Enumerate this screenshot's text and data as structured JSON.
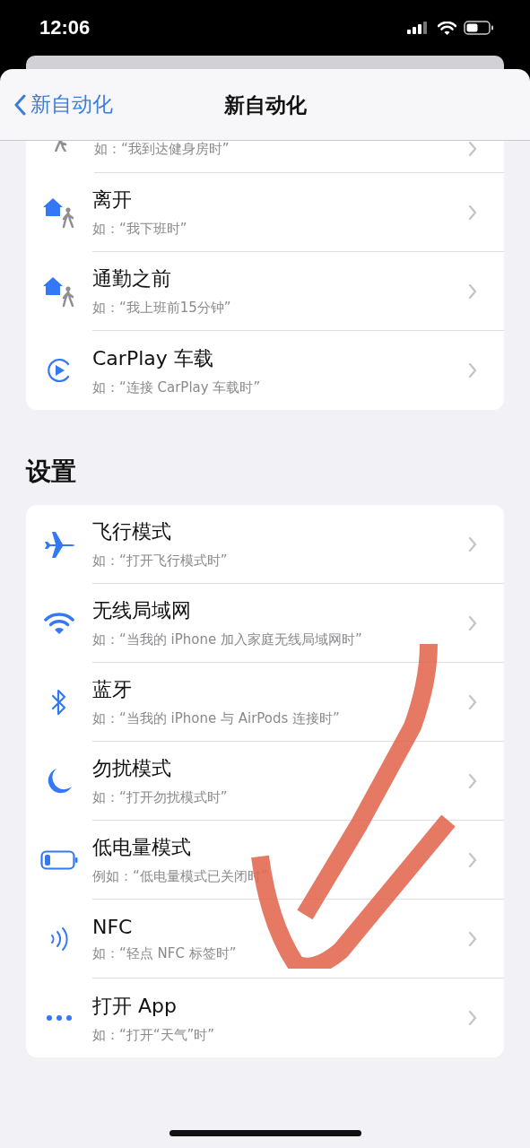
{
  "status_bar": {
    "time": "12:06"
  },
  "nav": {
    "back": "新自动化",
    "title": "新自动化"
  },
  "sections": [
    {
      "rows": [
        {
          "kind": "cut-off",
          "subtitle": "如：“我到达健身房时”"
        },
        {
          "kind": "home-person",
          "title": "离开",
          "subtitle": "如：“我下班时”"
        },
        {
          "kind": "home-person",
          "title": "通勤之前",
          "subtitle": "如：“我上班前15分钟”"
        },
        {
          "kind": "carplay",
          "title": "CarPlay 车载",
          "subtitle": "如：“连接 CarPlay 车载时”"
        }
      ]
    },
    {
      "header": "设置",
      "rows": [
        {
          "kind": "airplane",
          "title": "飞行模式",
          "subtitle": "如：“打开飞行模式时”"
        },
        {
          "kind": "wifi",
          "title": "无线局域网",
          "subtitle": "如：“当我的 iPhone 加入家庭无线局域网时”"
        },
        {
          "kind": "bluetooth",
          "title": "蓝牙",
          "subtitle": "如：“当我的 iPhone 与 AirPods 连接时”"
        },
        {
          "kind": "moon",
          "title": "勿扰模式",
          "subtitle": "如：“打开勿扰模式时”"
        },
        {
          "kind": "battery",
          "title": "低电量模式",
          "subtitle": "例如：“低电量模式已关闭时”"
        },
        {
          "kind": "nfc",
          "title": "NFC",
          "subtitle": "如：“轻点 NFC 标签时”"
        },
        {
          "kind": "more",
          "title": "打开 App",
          "subtitle": "如：“打开“天气”时”"
        }
      ]
    }
  ]
}
